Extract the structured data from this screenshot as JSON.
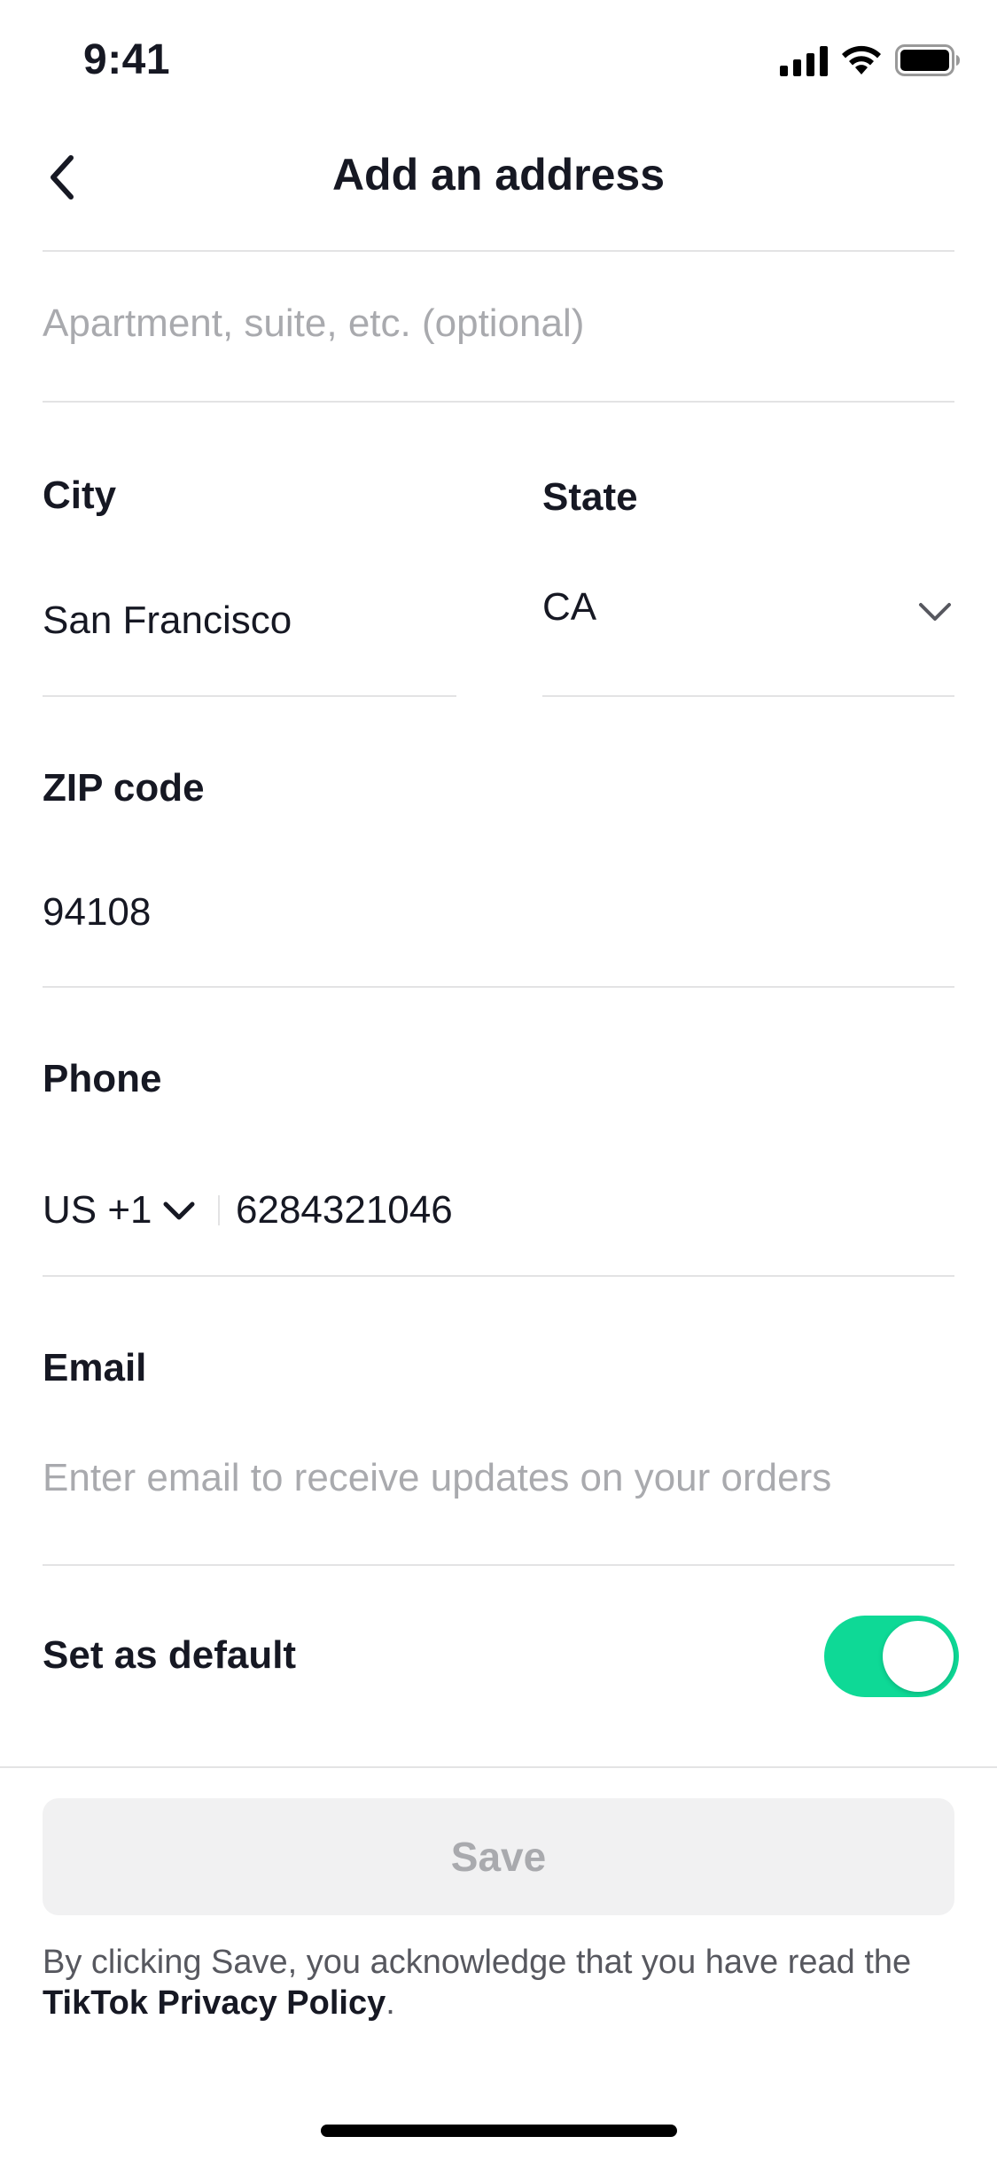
{
  "status_bar": {
    "time": "9:41"
  },
  "nav": {
    "title": "Add an address"
  },
  "form": {
    "apartment": {
      "placeholder": "Apartment, suite, etc. (optional)",
      "value": ""
    },
    "city": {
      "label": "City",
      "value": "San Francisco"
    },
    "state": {
      "label": "State",
      "value": "CA"
    },
    "zip": {
      "label": "ZIP code",
      "value": "94108"
    },
    "phone": {
      "label": "Phone",
      "country_code": "US +1",
      "value": "6284321046"
    },
    "email": {
      "label": "Email",
      "placeholder": "Enter email to receive updates on your orders",
      "value": ""
    },
    "default_toggle": {
      "label": "Set as default",
      "on": true
    }
  },
  "footer": {
    "save_label": "Save",
    "disclaimer_prefix": "By clicking Save, you acknowledge that you have read the ",
    "privacy_link": "TikTok Privacy Policy",
    "disclaimer_suffix": "."
  },
  "colors": {
    "toggle_on": "#0ed996",
    "save_disabled_bg": "#f1f1f2",
    "placeholder": "#a9aaae",
    "divider": "#e3e3e4"
  }
}
